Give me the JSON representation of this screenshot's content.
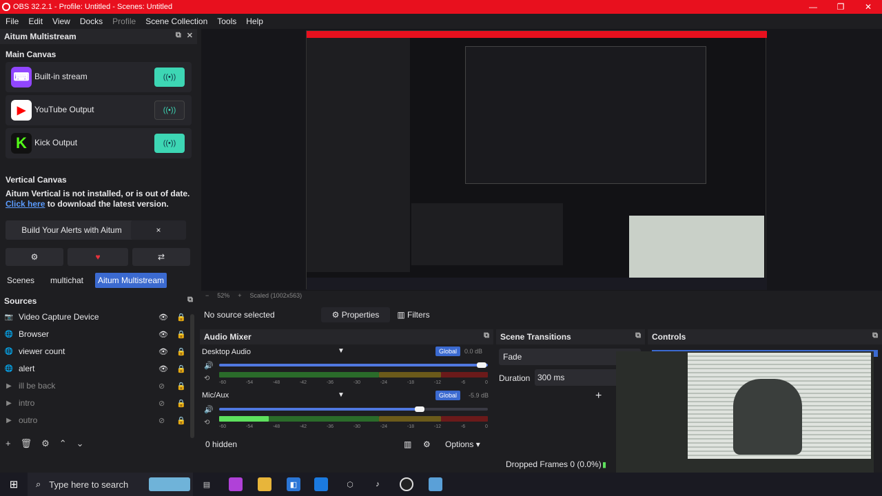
{
  "window": {
    "title": "OBS 32.2.1 - Profile: Untitled - Scenes: Untitled"
  },
  "menu": {
    "items": [
      "File",
      "Edit",
      "View",
      "Docks",
      "Profile",
      "Scene Collection",
      "Tools",
      "Help"
    ]
  },
  "aitum": {
    "title": "Aitum Multistream",
    "main_canvas": "Main Canvas",
    "outputs": [
      {
        "label": "Built-in stream",
        "icon": "twitch-icon",
        "enabled": true,
        "color": "#9146ff"
      },
      {
        "label": "YouTube Output",
        "icon": "youtube-icon",
        "enabled": false,
        "color": "#ff0000"
      },
      {
        "label": "Kick Output",
        "icon": "kick-icon",
        "enabled": true,
        "color": "#53fc18"
      }
    ],
    "vertical_canvas": "Vertical Canvas",
    "vertical_msg": "Aitum Vertical is not installed, or is out of date.",
    "click_here": "Click here",
    "download_msg": " to download the latest version.",
    "alerts_button": "Build Your Alerts with Aitum",
    "close": "×",
    "tabs": [
      "Scenes",
      "multichat",
      "Aitum Multistream"
    ],
    "active_tab": "Aitum Multistream",
    "accent": "#3dd6b4"
  },
  "sources": {
    "title": "Sources",
    "items": [
      {
        "label": "Video Capture Device",
        "icon": "camera-icon",
        "visible": true
      },
      {
        "label": "Browser",
        "icon": "globe-icon",
        "visible": true
      },
      {
        "label": "viewer count",
        "icon": "globe-icon",
        "visible": true
      },
      {
        "label": "alert",
        "icon": "globe-icon",
        "visible": true
      },
      {
        "label": "ill be back",
        "icon": "play-icon",
        "visible": false
      },
      {
        "label": "intro",
        "icon": "play-icon",
        "visible": false
      },
      {
        "label": "outro",
        "icon": "play-icon",
        "visible": false
      }
    ]
  },
  "preview": {
    "zoom": "52%",
    "scaled": "Scaled (1002x563)"
  },
  "context": {
    "no_source": "No source selected",
    "properties": "Properties",
    "filters": "Filters"
  },
  "mixer": {
    "title": "Audio Mixer",
    "channels": [
      {
        "name": "Desktop Audio",
        "db": "0.0 dB",
        "global": "Global",
        "volume": 1.0,
        "level": 0.0
      },
      {
        "name": "Mic/Aux",
        "db": "-5.9 dB",
        "global": "Global",
        "volume": 0.77,
        "level": 0.2
      }
    ],
    "ticks": [
      "-60",
      "-54",
      "-48",
      "-42",
      "-36",
      "-30",
      "-24",
      "-18",
      "-12",
      "-6",
      "0"
    ],
    "hidden": "0 hidden",
    "options": "Options"
  },
  "transitions": {
    "title": "Scene Transitions",
    "type": "Fade",
    "duration_label": "Duration",
    "duration": "300 ms"
  },
  "controls": {
    "title": "Controls"
  },
  "status": {
    "dropped": "Dropped Frames 0 (0.0%)"
  },
  "taskbar": {
    "search_placeholder": "Type here to search"
  }
}
